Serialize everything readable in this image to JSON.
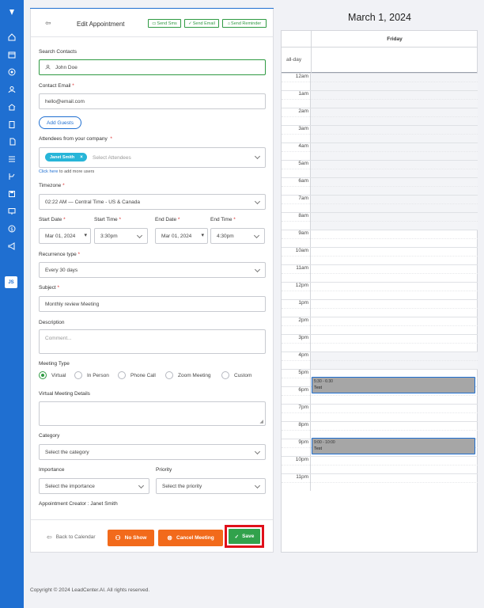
{
  "nav": {
    "icons": [
      "logo-icon",
      "home-icon",
      "calendar-icon",
      "target-icon",
      "contacts-icon",
      "house-icon",
      "clipboard-icon",
      "files-icon",
      "list-icon",
      "branch-icon",
      "save-icon",
      "monitor-icon",
      "dollar-icon",
      "megaphone-icon"
    ],
    "avatar": "JS"
  },
  "form": {
    "title": "Edit Appointment",
    "header_buttons": {
      "send_sms": "Send Sms",
      "send_email": "Send Email",
      "send_reminder": "Send Reminder"
    },
    "search_contacts": {
      "label": "Search Contacts",
      "value": "John Doe"
    },
    "contact_email": {
      "label": "Contact Email",
      "required": "*",
      "value": "hello@email.com"
    },
    "add_guests": "Add Guests",
    "attendees": {
      "label": "Attendees from your company",
      "required": "*",
      "chip": "Janet Smith",
      "chip_remove": "×",
      "placeholder": "Select Attendees",
      "hint_link": "Click here",
      "hint_rest": " to add more users"
    },
    "timezone": {
      "label": "Timezone",
      "required": "*",
      "value": "02:22 AM — Central Time - US & Canada"
    },
    "start_date": {
      "label": "Start Date",
      "required": "*",
      "value": "Mar 01, 2024"
    },
    "start_time": {
      "label": "Start Time",
      "required": "*",
      "value": "3:30pm"
    },
    "end_date": {
      "label": "End Date",
      "required": "*",
      "value": "Mar 01, 2024"
    },
    "end_time": {
      "label": "End Time",
      "required": "*",
      "value": "4:30pm"
    },
    "recurrence": {
      "label": "Recurrence type",
      "required": "*",
      "value": "Every 30 days"
    },
    "subject": {
      "label": "Subject",
      "required": "*",
      "value": "Monthly review Meeting"
    },
    "description": {
      "label": "Description",
      "placeholder": "Comment..."
    },
    "meeting_type": {
      "label": "Meeting Type",
      "options": [
        "Virtual",
        "In Person",
        "Phone Call",
        "Zoom Meeting",
        "Custom"
      ],
      "selected": "Virtual"
    },
    "virtual_details": {
      "label": "Virtual Meeting Details"
    },
    "category": {
      "label": "Category",
      "placeholder": "Select the category"
    },
    "importance": {
      "label": "Importance",
      "placeholder": "Select the importance"
    },
    "priority": {
      "label": "Priority",
      "placeholder": "Select the priority"
    },
    "creator": "Appointment Creator : Janet Smith",
    "footer": {
      "back": "Back to Calendar",
      "no_show": "No Show",
      "cancel": "Cancel Meeting",
      "save": "Save"
    }
  },
  "calendar": {
    "title": "March 1, 2024",
    "day": "Friday",
    "allday_label": "all-day",
    "hours": [
      "12am",
      "1am",
      "2am",
      "3am",
      "4am",
      "5am",
      "6am",
      "7am",
      "8am",
      "9am",
      "10am",
      "11am",
      "12pm",
      "1pm",
      "2pm",
      "3pm",
      "4pm",
      "5pm",
      "6pm",
      "7pm",
      "8pm",
      "9pm",
      "10pm",
      "11pm"
    ],
    "events": [
      {
        "time": "5:30 - 6:30",
        "title": "Test"
      },
      {
        "time": "9:00 - 10:00",
        "title": "Test"
      }
    ]
  },
  "copyright": "Copyright © 2024 LeadCenter.AI. All rights reserved."
}
